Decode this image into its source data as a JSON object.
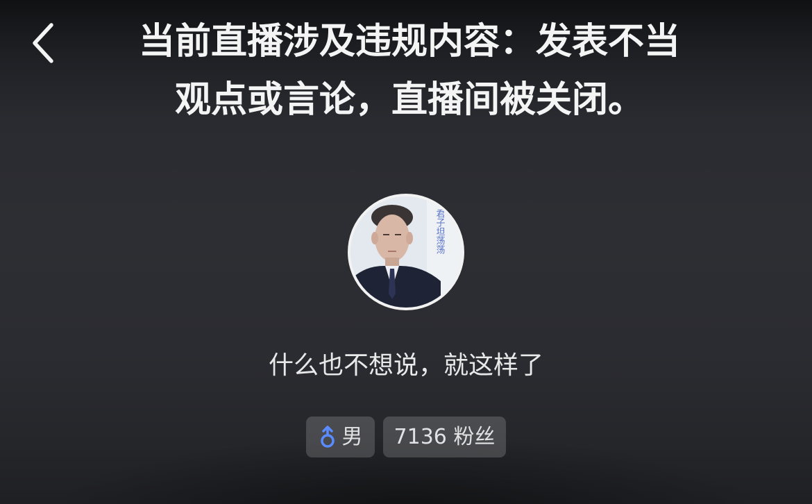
{
  "header": {
    "back_icon": "chevron-left-icon",
    "notice_line1": "当前直播涉及违规内容：发表不当",
    "notice_line2": "观点或言论，直播间被关闭。"
  },
  "profile": {
    "avatar_text": "君子坦荡荡",
    "bio": "什么也不想说，就这样了",
    "gender_icon": "male-icon",
    "gender_label": "男",
    "fans_label": "7136 粉丝"
  },
  "colors": {
    "accent_male": "#5a8cff",
    "tag_background": "rgba(255,255,255,0.17)"
  }
}
